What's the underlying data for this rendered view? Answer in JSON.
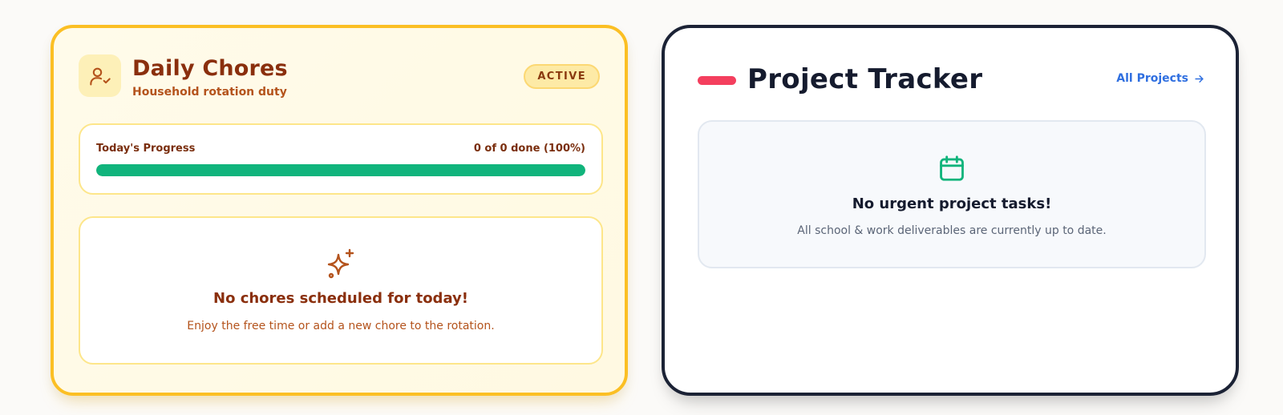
{
  "chores": {
    "title": "Daily Chores",
    "subtitle": "Household rotation duty",
    "badge": "ACTIVE",
    "avatar_icon": "user-check-icon",
    "progress": {
      "label": "Today's Progress",
      "value_text": "0 of 0 done (100%)",
      "percent": 100
    },
    "empty": {
      "icon": "sparkles-icon",
      "title": "No chores scheduled for today!",
      "text": "Enjoy the free time or add a new chore to the rotation."
    },
    "colors": {
      "border": "#fbbf24",
      "title": "#8a2f0d",
      "progress_fill": "#10b47c"
    }
  },
  "projects": {
    "title": "Project Tracker",
    "link_label": "All Projects",
    "link_icon": "arrow-right-icon",
    "empty": {
      "icon": "calendar-icon",
      "title": "No urgent project tasks!",
      "text": "All school & work deliverables are currently up to date."
    },
    "colors": {
      "border": "#1b2235",
      "accent": "#f43f5e",
      "link": "#2f6fe0",
      "icon": "#10b47c"
    }
  }
}
